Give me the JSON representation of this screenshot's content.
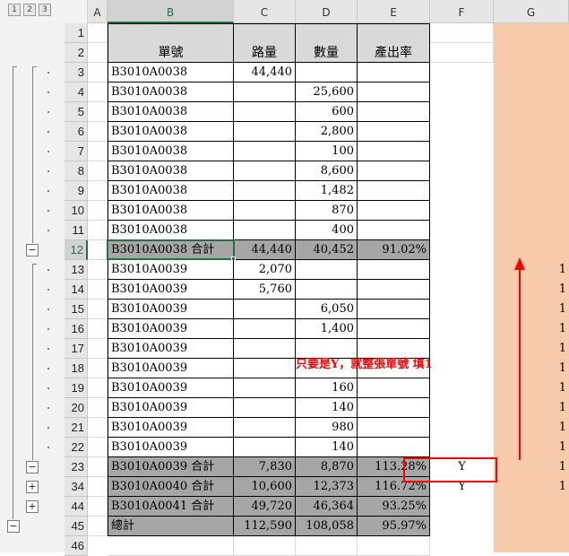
{
  "outline_levels": [
    "1",
    "2",
    "3"
  ],
  "columns": [
    "A",
    "B",
    "C",
    "D",
    "E",
    "F",
    "G"
  ],
  "header_rows": [
    "1",
    "2"
  ],
  "headers": {
    "order_no": "單號",
    "route_qty": "路量",
    "quantity": "數量",
    "yield_rate": "產出率"
  },
  "rows": [
    {
      "row": "3",
      "b": "B3010A0038",
      "c": "44,440",
      "d": "",
      "e": "",
      "f": "",
      "g": ""
    },
    {
      "row": "4",
      "b": "B3010A0038",
      "c": "",
      "d": "25,600",
      "e": "",
      "f": "",
      "g": ""
    },
    {
      "row": "5",
      "b": "B3010A0038",
      "c": "",
      "d": "600",
      "e": "",
      "f": "",
      "g": ""
    },
    {
      "row": "6",
      "b": "B3010A0038",
      "c": "",
      "d": "2,800",
      "e": "",
      "f": "",
      "g": ""
    },
    {
      "row": "7",
      "b": "B3010A0038",
      "c": "",
      "d": "100",
      "e": "",
      "f": "",
      "g": ""
    },
    {
      "row": "8",
      "b": "B3010A0038",
      "c": "",
      "d": "8,600",
      "e": "",
      "f": "",
      "g": ""
    },
    {
      "row": "9",
      "b": "B3010A0038",
      "c": "",
      "d": "1,482",
      "e": "",
      "f": "",
      "g": ""
    },
    {
      "row": "10",
      "b": "B3010A0038",
      "c": "",
      "d": "870",
      "e": "",
      "f": "",
      "g": ""
    },
    {
      "row": "11",
      "b": "B3010A0038",
      "c": "",
      "d": "400",
      "e": "",
      "f": "",
      "g": ""
    },
    {
      "row": "12",
      "b": "B3010A0038 合計",
      "c": "44,440",
      "d": "40,452",
      "e": "91.02%",
      "f": "",
      "g": "",
      "subtotal": true
    },
    {
      "row": "13",
      "b": "B3010A0039",
      "c": "2,070",
      "d": "",
      "e": "",
      "f": "",
      "g": "1"
    },
    {
      "row": "14",
      "b": "B3010A0039",
      "c": "5,760",
      "d": "",
      "e": "",
      "f": "",
      "g": "1"
    },
    {
      "row": "15",
      "b": "B3010A0039",
      "c": "",
      "d": "6,050",
      "e": "",
      "f": "",
      "g": "1"
    },
    {
      "row": "16",
      "b": "B3010A0039",
      "c": "",
      "d": "1,400",
      "e": "",
      "f": "",
      "g": "1"
    },
    {
      "row": "17",
      "b": "B3010A0039",
      "c": "",
      "d": "",
      "e": "",
      "f": "",
      "g": "1"
    },
    {
      "row": "18",
      "b": "B3010A0039",
      "c": "",
      "d": "",
      "e": "",
      "f": "",
      "g": "1"
    },
    {
      "row": "19",
      "b": "B3010A0039",
      "c": "",
      "d": "160",
      "e": "",
      "f": "",
      "g": "1"
    },
    {
      "row": "20",
      "b": "B3010A0039",
      "c": "",
      "d": "140",
      "e": "",
      "f": "",
      "g": "1"
    },
    {
      "row": "21",
      "b": "B3010A0039",
      "c": "",
      "d": "980",
      "e": "",
      "f": "",
      "g": "1"
    },
    {
      "row": "22",
      "b": "B3010A0039",
      "c": "",
      "d": "140",
      "e": "",
      "f": "",
      "g": "1"
    },
    {
      "row": "23",
      "b": "B3010A0039 合計",
      "c": "7,830",
      "d": "8,870",
      "e": "113.28%",
      "f": "Y",
      "g": "1",
      "subtotal": true
    },
    {
      "row": "34",
      "b": "B3010A0040 合計",
      "c": "10,600",
      "d": "12,373",
      "e": "116.72%",
      "f": "Y",
      "g": "1",
      "subtotal": true
    },
    {
      "row": "44",
      "b": "B3010A0041 合計",
      "c": "49,720",
      "d": "46,364",
      "e": "93.25%",
      "f": "",
      "g": "",
      "subtotal": true
    },
    {
      "row": "45",
      "b": "總計",
      "c": "112,590",
      "d": "108,058",
      "e": "95.97%",
      "f": "",
      "g": "",
      "subtotal": true
    }
  ],
  "last_row": "46",
  "annotation": "只要是Y，就整張單號 填1",
  "outline_buttons": {
    "collapse": "−",
    "expand": "+"
  },
  "colors": {
    "subtotal_fill": "#a6a6a6",
    "header_fill": "#d9d9d9",
    "column_g_fill": "#f8cbad",
    "annotation_red": "#ff0000",
    "selection_green": "#217346"
  }
}
